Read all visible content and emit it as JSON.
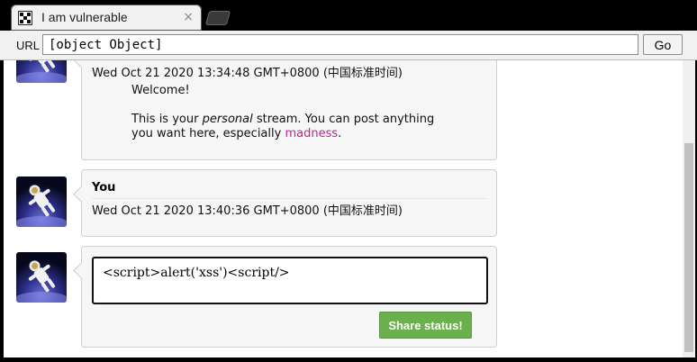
{
  "browser": {
    "tab_title": "I am vulnerable",
    "tab_close": "×",
    "url_label": "URL",
    "url_value": "[object Object]",
    "go_label": "Go"
  },
  "stream": {
    "posts": [
      {
        "date": "Wed Oct 21 2020 13:34:48 GMT+0800 (中国标准时间)",
        "message_line1": "Welcome!",
        "message_before_em": "This is your ",
        "message_em": "personal",
        "message_after_em": " stream. You can post anything you want here, especially ",
        "message_link": "madness",
        "message_end": "."
      },
      {
        "author": "You",
        "date": "Wed Oct 21 2020 13:40:36 GMT+0800 (中国标准时间)"
      }
    ],
    "composer": {
      "value": "<script>alert('xss')<script/>",
      "share_label": "Share status!"
    }
  },
  "icons": {
    "favicon": "pixel-grid-icon",
    "avatar": "astronaut-avatar"
  },
  "colors": {
    "share_button": "#6ab04c",
    "link": "#c0238c",
    "window_frame": "#000000"
  }
}
